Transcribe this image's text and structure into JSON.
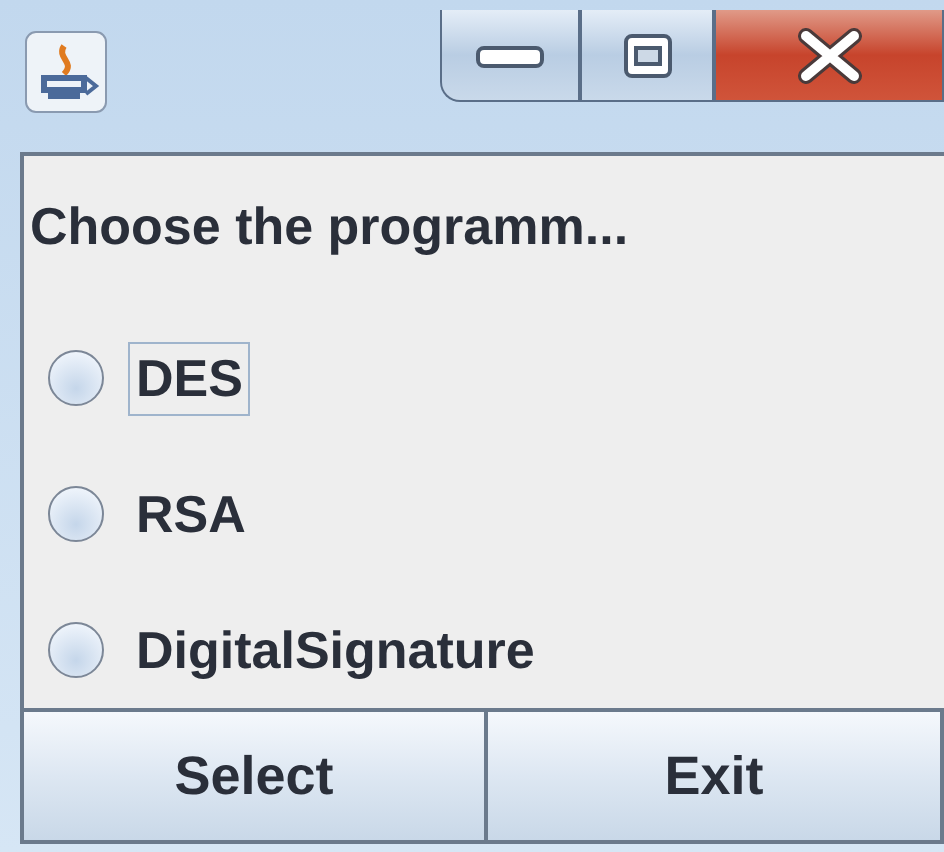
{
  "window": {
    "controls": [
      {
        "kind": "minimize"
      },
      {
        "kind": "maximize"
      },
      {
        "kind": "close"
      }
    ]
  },
  "prompt": "Choose the programm...",
  "options": [
    {
      "label": "DES",
      "selected": false,
      "focused": true
    },
    {
      "label": "RSA",
      "selected": false,
      "focused": false
    },
    {
      "label": "DigitalSignature",
      "selected": false,
      "focused": false
    }
  ],
  "buttons": [
    "Select",
    "Exit"
  ]
}
